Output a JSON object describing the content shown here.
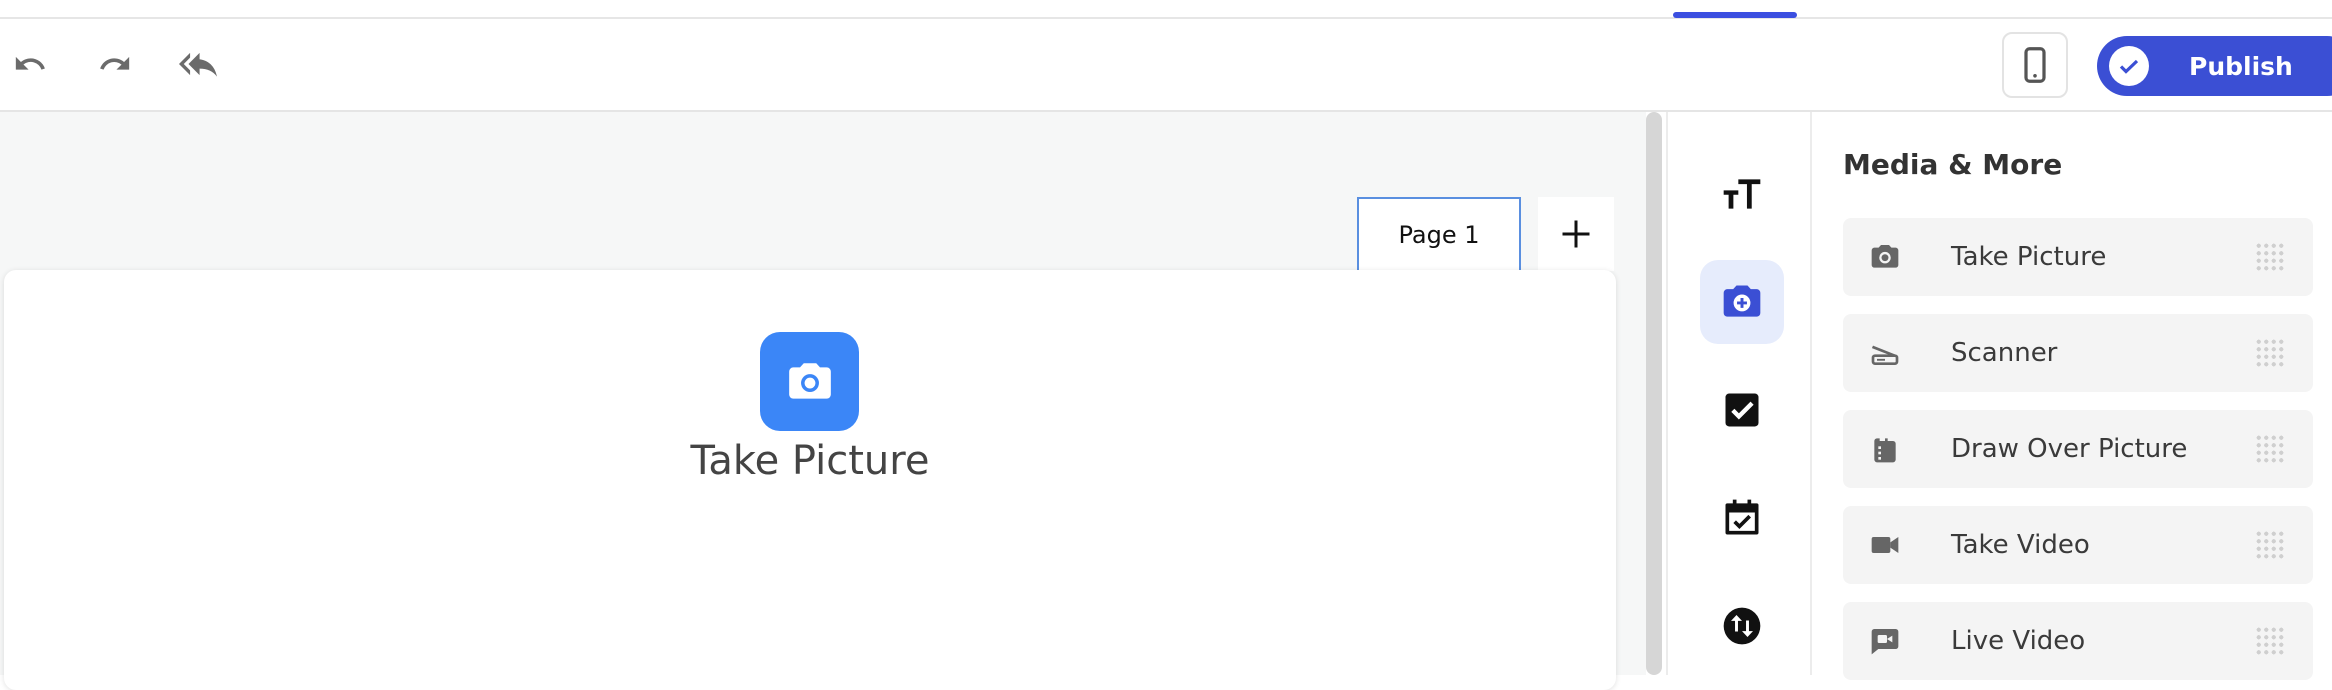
{
  "toolbar": {
    "undo_icon": "undo-icon",
    "redo_icon": "redo-icon",
    "reply_all_icon": "reply-all-icon",
    "device_icon": "mobile-phone-icon",
    "publish_label": "Publish",
    "publish_icon": "check-circle-icon"
  },
  "canvas": {
    "page_tab_label": "Page 1",
    "add_page_icon": "plus-icon",
    "field": {
      "icon": "camera-icon",
      "label": "Take Picture"
    }
  },
  "icon_rail": {
    "items": [
      {
        "icon": "text-size-icon",
        "active": false
      },
      {
        "icon": "camera-plus-icon",
        "active": true
      },
      {
        "icon": "checkbox-icon",
        "active": false
      },
      {
        "icon": "calendar-check-icon",
        "active": false
      },
      {
        "icon": "swap-vertical-icon",
        "active": false
      }
    ]
  },
  "panel": {
    "title": "Media & More",
    "items": [
      {
        "label": "Take Picture",
        "icon": "camera-icon"
      },
      {
        "label": "Scanner",
        "icon": "scanner-icon"
      },
      {
        "label": "Draw Over Picture",
        "icon": "film-draw-icon"
      },
      {
        "label": "Take Video",
        "icon": "video-camera-icon"
      },
      {
        "label": "Live Video",
        "icon": "live-video-chat-icon"
      }
    ]
  },
  "colors": {
    "accent": "#3b4fd4",
    "field_icon_bg": "#3b86f7",
    "rail_active_bg": "#e6ecfc"
  }
}
